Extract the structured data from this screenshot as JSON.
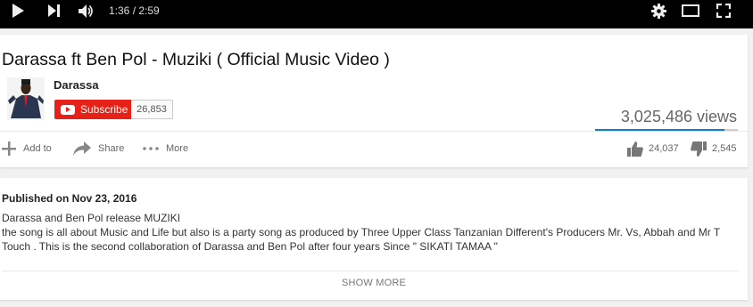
{
  "player": {
    "time": "1:36 / 2:59",
    "icons": [
      "play-icon",
      "next-icon",
      "volume-icon",
      "settings-gear-icon",
      "theater-mode-icon",
      "fullscreen-icon"
    ]
  },
  "video": {
    "title": "Darassa ft Ben Pol - Muziki ( Official Music Video )",
    "views": "3,025,486 views",
    "like_ratio": 0.904
  },
  "channel": {
    "name": "Darassa",
    "subscribe_label": "Subscribe",
    "subscriber_count": "26,853"
  },
  "actions": {
    "add_label": "Add to",
    "share_label": "Share",
    "more_label": "More"
  },
  "ratings": {
    "likes": "24,037",
    "dislikes": "2,545"
  },
  "description": {
    "published": "Published on Nov 23, 2016",
    "lines": [
      "Darassa and Ben Pol release MUZIKI",
      "the song is all about Music and Life but also is a party song as produced by Three Upper Class Tanzanian Different's Producers Mr. Vs, Abbah and Mr T Touch . This is the second collaboration of Darassa and Ben Pol after four years Since \" SIKATI TAMAA \""
    ],
    "show_more_label": "SHOW MORE"
  },
  "colors": {
    "accent_blue": "#167ac6",
    "subscribe_red": "#e62117",
    "player_bg": "#000000"
  }
}
